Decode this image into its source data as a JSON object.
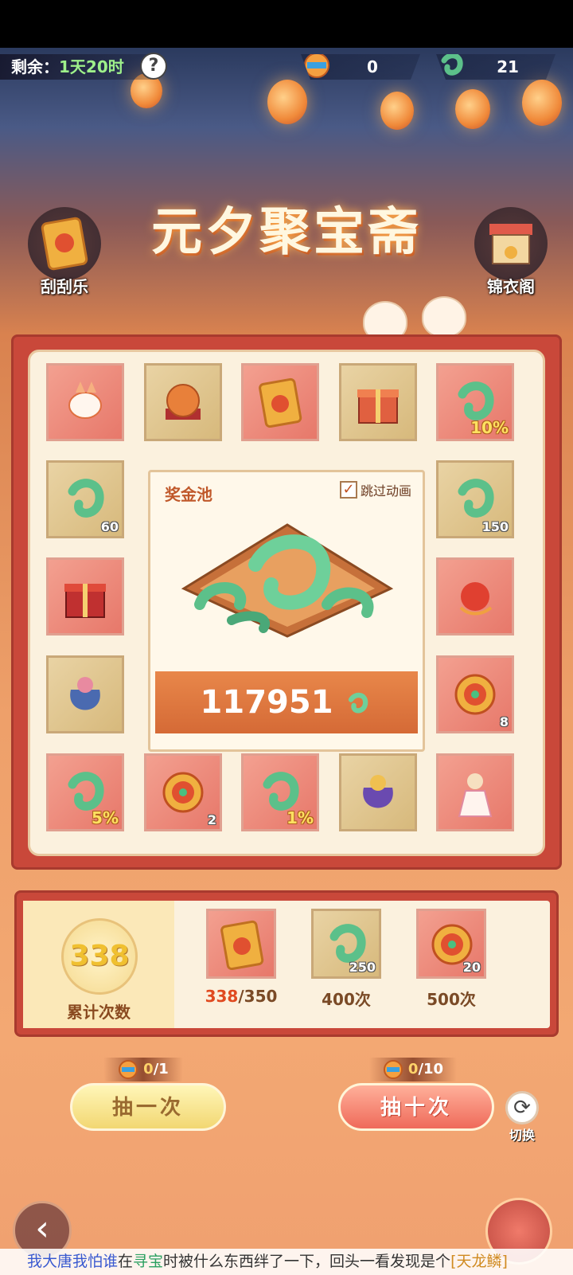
{
  "topbar": {
    "remain_label": "剩余：",
    "remain_time": "1天20时",
    "help_icon": "?",
    "currency1_value": "0",
    "currency2_value": "21"
  },
  "title": "元夕聚宝斋",
  "side": {
    "scratch_label": "刮刮乐",
    "wardrobe_label": "锦衣阁"
  },
  "grid": {
    "r1": [
      {
        "icon": "fox-mount-icon",
        "color": "red",
        "badge": ""
      },
      {
        "icon": "orb-icon",
        "color": "gold",
        "badge": ""
      },
      {
        "icon": "scratch-card-icon",
        "color": "red",
        "badge": ""
      },
      {
        "icon": "gift-box-icon",
        "color": "gold",
        "badge": ""
      },
      {
        "icon": "jade-dragon-icon",
        "color": "red",
        "badge": "10%"
      }
    ],
    "left": [
      {
        "icon": "jade-dragon-icon",
        "color": "gold",
        "badge": "60"
      },
      {
        "icon": "red-gift-box-icon",
        "color": "red",
        "badge": ""
      },
      {
        "icon": "lucky-bag-icon",
        "color": "gold",
        "badge": ""
      }
    ],
    "right": [
      {
        "icon": "jade-dragon-icon",
        "color": "gold",
        "badge": "150"
      },
      {
        "icon": "phoenix-ornament-icon",
        "color": "red",
        "badge": ""
      },
      {
        "icon": "flower-coin-icon",
        "color": "red",
        "badge": "8"
      }
    ],
    "r5": [
      {
        "icon": "jade-dragon-icon",
        "color": "red",
        "badge": "5%"
      },
      {
        "icon": "flower-coin-icon",
        "color": "red",
        "badge": "2"
      },
      {
        "icon": "jade-dragon-icon",
        "color": "red",
        "badge": "1%"
      },
      {
        "icon": "purple-bag-icon",
        "color": "gold",
        "badge": ""
      },
      {
        "icon": "costume-character-icon",
        "color": "red",
        "badge": ""
      }
    ]
  },
  "pool": {
    "title": "奖金池",
    "skip_label": "跳过动画",
    "skip_checked": "✓",
    "amount": "117951"
  },
  "counter": {
    "value": "338",
    "label": "累计次数",
    "milestones": [
      {
        "icon": "scratch-card-icon",
        "badge": "",
        "label_hl": "338",
        "label_rest": "/350"
      },
      {
        "icon": "jade-dragon-icon",
        "badge": "250",
        "label_hl": "",
        "label_rest": "400次"
      },
      {
        "icon": "flower-coin-icon",
        "badge": "20",
        "label_hl": "",
        "label_rest": "500次"
      }
    ]
  },
  "draw": {
    "one_cost_hl": "0",
    "one_cost_rest": "/1",
    "one_label": "抽一次",
    "ten_cost_hl": "0",
    "ten_cost_rest": "/10",
    "ten_label": "抽十次",
    "switch_label": "切换"
  },
  "ticker": {
    "part1": "我大唐我怕谁",
    "part2": "在",
    "part3": "寻宝",
    "part4": "时被什么东西绊了一下，回头一看发现是个",
    "part5": "[天龙鳞]"
  },
  "colors": {
    "board_red": "#c9483a",
    "panel_cream": "#fbf1de",
    "pool_orange": "#d56a36",
    "jade_green": "#5cc08a"
  }
}
